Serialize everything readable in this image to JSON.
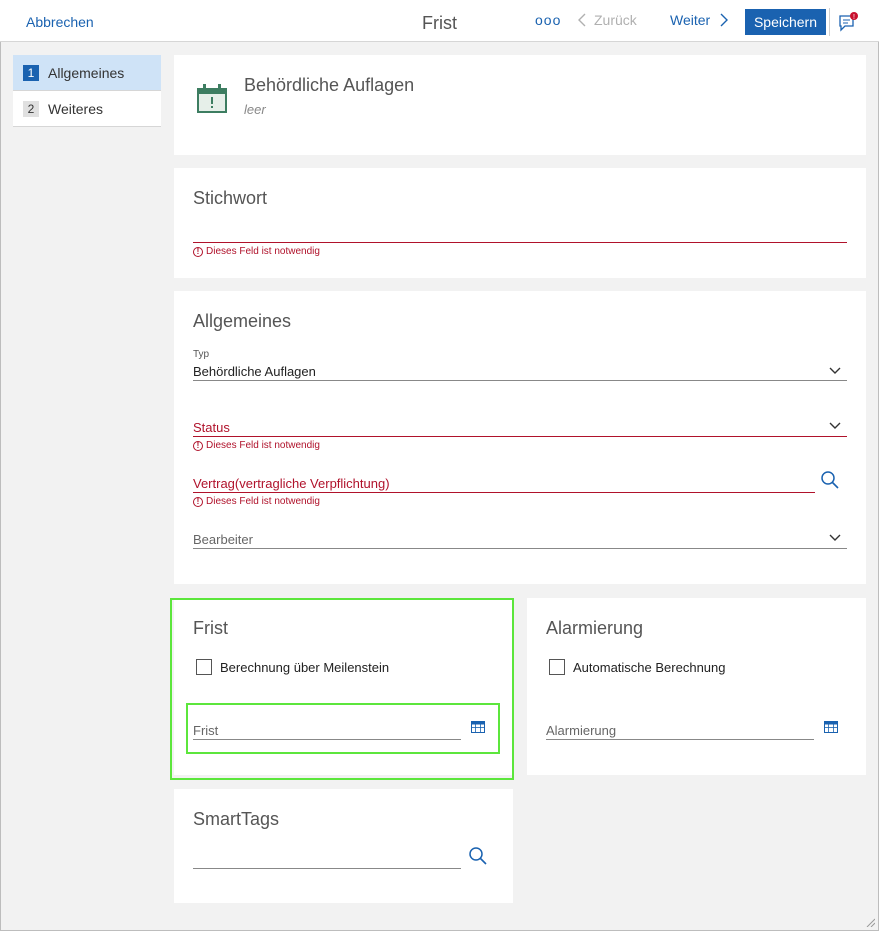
{
  "topbar": {
    "cancel": "Abbrechen",
    "title": "Frist",
    "more": "ooo",
    "back": "Zurück",
    "next": "Weiter",
    "save": "Speichern",
    "chat_badge": "!"
  },
  "sidebar": {
    "items": [
      {
        "num": "1",
        "label": "Allgemeines"
      },
      {
        "num": "2",
        "label": "Weiteres"
      }
    ]
  },
  "header_card": {
    "title": "Behördliche Auflagen",
    "subtitle": "leer"
  },
  "stichwort_card": {
    "title": "Stichwort",
    "error": "Dieses Feld ist notwendig"
  },
  "allgemeines_card": {
    "title": "Allgemeines",
    "typ_label": "Typ",
    "typ_value": "Behördliche Auflagen",
    "status_label": "Status",
    "status_error": "Dieses Feld ist notwendig",
    "vertrag_label": "Vertrag(vertragliche Verpflichtung)",
    "vertrag_error": "Dieses Feld ist notwendig",
    "bearbeiter_label": "Bearbeiter"
  },
  "frist_card": {
    "title": "Frist",
    "checkbox_label": "Berechnung über Meilenstein",
    "field_label": "Frist"
  },
  "alarm_card": {
    "title": "Alarmierung",
    "checkbox_label": "Automatische Berechnung",
    "field_label": "Alarmierung"
  },
  "smarttags_card": {
    "title": "SmartTags"
  },
  "colors": {
    "accent": "#1a62b0",
    "error": "#b0122b",
    "highlight": "#5ce63c",
    "calendar_icon": "#3d7d61"
  }
}
